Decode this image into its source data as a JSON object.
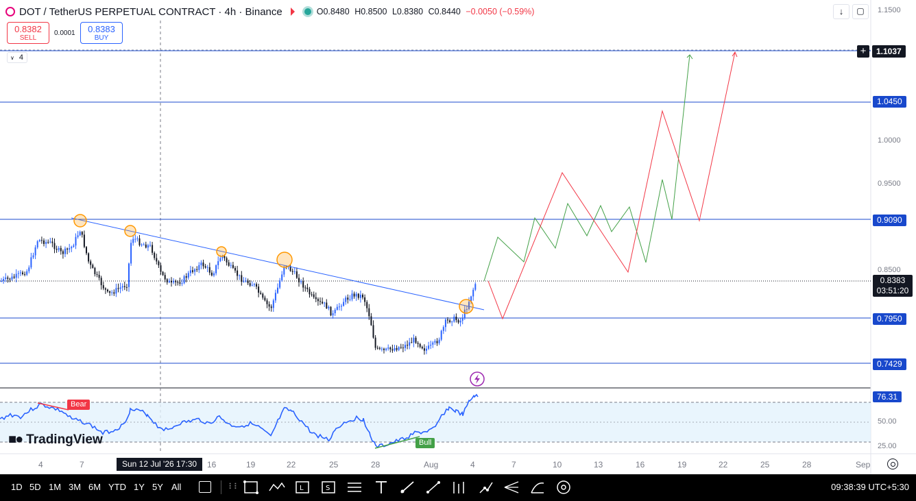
{
  "header": {
    "symbol": "DOT / TetherUS PERPETUAL CONTRACT · 4h · Binance",
    "open": "O0.8480",
    "high": "H0.8500",
    "low": "L0.8380",
    "close": "C0.8440",
    "change": "−0.0050 (−0.59%)"
  },
  "trade": {
    "sell_price": "0.8382",
    "sell_label": "SELL",
    "spread": "0.0001",
    "buy_price": "0.8383",
    "buy_label": "BUY"
  },
  "indicator_count": "4",
  "price_axis": {
    "ticks": [
      "1.1500",
      "1.0000",
      "0.9500",
      "0.8500"
    ],
    "level_labels": [
      "1.1037",
      "1.0450",
      "0.9090",
      "0.7950",
      "0.7429"
    ],
    "current_price": "0.8383",
    "countdown": "03:51:20"
  },
  "rsi": {
    "value": "76.31",
    "ticks": [
      "50.00",
      "25.00"
    ],
    "bear_label": "Bear",
    "bull_label": "Bull"
  },
  "time_axis": {
    "labels": [
      "4",
      "7",
      "16",
      "19",
      "22",
      "25",
      "28",
      "Aug",
      "4",
      "7",
      "10",
      "13",
      "16",
      "19",
      "22",
      "25",
      "28",
      "Sep"
    ],
    "crosshair_time": "Sun 12 Jul '26   17:30"
  },
  "logo": "TradingView",
  "bottombar": {
    "timeframes": [
      "1D",
      "5D",
      "1M",
      "3M",
      "6M",
      "YTD",
      "1Y",
      "5Y",
      "All"
    ],
    "clock": "09:38:39 UTC+5:30"
  },
  "colors": {
    "accent": "#1848cc",
    "up": "#2962ff",
    "down": "#131722",
    "bear": "#f23645",
    "bull": "#43a047",
    "rsi_band": "#e3f2fd"
  }
}
